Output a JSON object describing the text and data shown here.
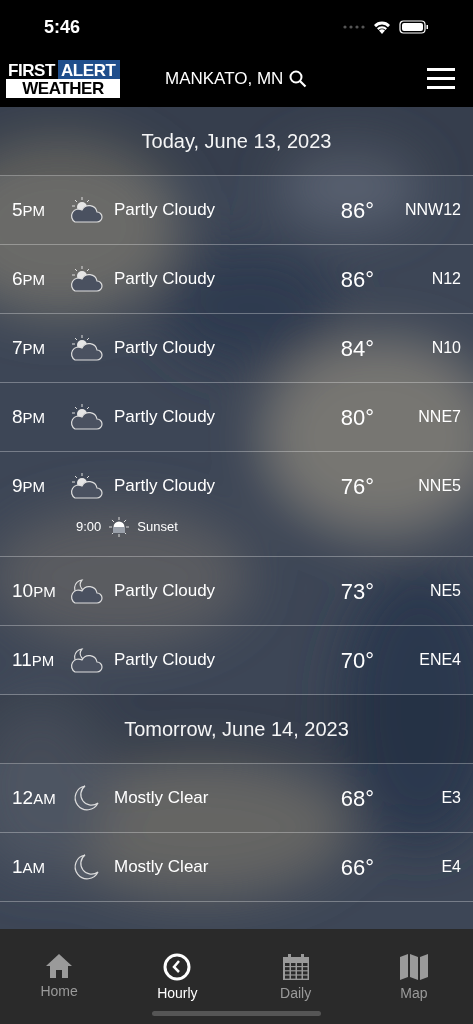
{
  "status_bar": {
    "time": "5:46"
  },
  "header": {
    "logo_top_left": "FIRST",
    "logo_top_right": "ALERT",
    "logo_bottom": "WEATHER",
    "location": "MANKATO, MN"
  },
  "sections": [
    {
      "title": "Today, June 13, 2023",
      "rows": [
        {
          "hour": "5",
          "period": "PM",
          "kind": "sun-cloud",
          "condition": "Partly Cloudy",
          "temp": "86°",
          "wind": "NNW12"
        },
        {
          "hour": "6",
          "period": "PM",
          "kind": "sun-cloud",
          "condition": "Partly Cloudy",
          "temp": "86°",
          "wind": "N12"
        },
        {
          "hour": "7",
          "period": "PM",
          "kind": "sun-cloud",
          "condition": "Partly Cloudy",
          "temp": "84°",
          "wind": "N10"
        },
        {
          "hour": "8",
          "period": "PM",
          "kind": "sun-cloud",
          "condition": "Partly Cloudy",
          "temp": "80°",
          "wind": "NNE7"
        },
        {
          "hour": "9",
          "period": "PM",
          "kind": "sun-cloud",
          "condition": "Partly Cloudy",
          "temp": "76°",
          "wind": "NNE5",
          "event": {
            "time": "9:00",
            "label": "Sunset"
          }
        },
        {
          "hour": "10",
          "period": "PM",
          "kind": "moon-cloud",
          "condition": "Partly Cloudy",
          "temp": "73°",
          "wind": "NE5"
        },
        {
          "hour": "11",
          "period": "PM",
          "kind": "moon-cloud",
          "condition": "Partly Cloudy",
          "temp": "70°",
          "wind": "ENE4"
        }
      ]
    },
    {
      "title": "Tomorrow, June 14, 2023",
      "rows": [
        {
          "hour": "12",
          "period": "AM",
          "kind": "moon",
          "condition": "Mostly Clear",
          "temp": "68°",
          "wind": "E3"
        },
        {
          "hour": "1",
          "period": "AM",
          "kind": "moon",
          "condition": "Mostly Clear",
          "temp": "66°",
          "wind": "E4"
        }
      ]
    }
  ],
  "tabs": [
    {
      "label": "Home",
      "kind": "home",
      "selected": false
    },
    {
      "label": "Hourly",
      "kind": "clock",
      "selected": true
    },
    {
      "label": "Daily",
      "kind": "calendar",
      "selected": false
    },
    {
      "label": "Map",
      "kind": "map",
      "selected": false
    }
  ]
}
